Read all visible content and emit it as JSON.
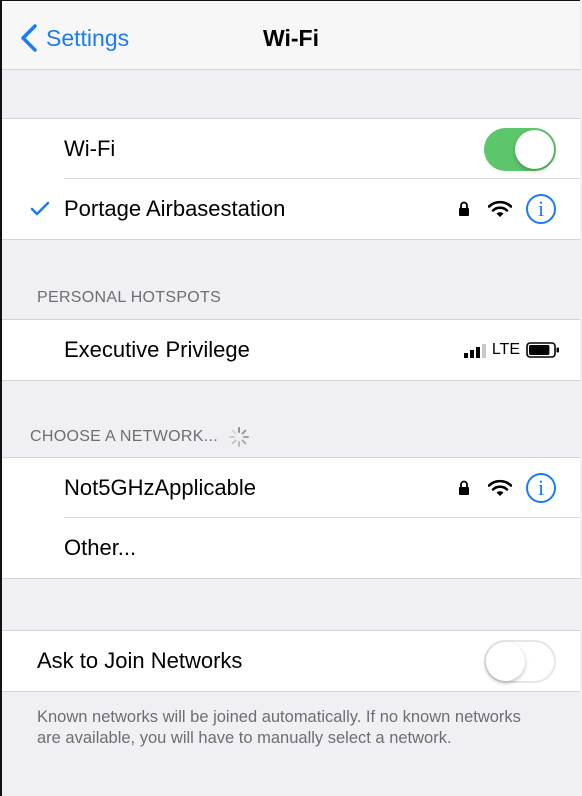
{
  "navbar": {
    "back_label": "Settings",
    "title": "Wi-Fi"
  },
  "wifi": {
    "label": "Wi-Fi",
    "enabled": true
  },
  "connected_network": {
    "name": "Portage Airbasestation",
    "secured": true,
    "info": "i"
  },
  "personal_hotspots": {
    "header": "PERSONAL HOTSPOTS",
    "items": [
      {
        "name": "Executive Privilege",
        "network_type": "LTE",
        "battery_level": 0.85
      }
    ]
  },
  "choose_network": {
    "header": "CHOOSE A NETWORK...",
    "items": [
      {
        "name": "Not5GHzApplicable",
        "secured": true,
        "info": "i"
      },
      {
        "name": "Other..."
      }
    ]
  },
  "ask_to_join": {
    "label": "Ask to Join Networks",
    "enabled": false,
    "footer": "Known networks will be joined automatically. If no known networks are available, you will have to manually select a network."
  },
  "colors": {
    "accent": "#1a7cf5",
    "toggle_on": "#5cc66a",
    "background": "#efeff4"
  }
}
